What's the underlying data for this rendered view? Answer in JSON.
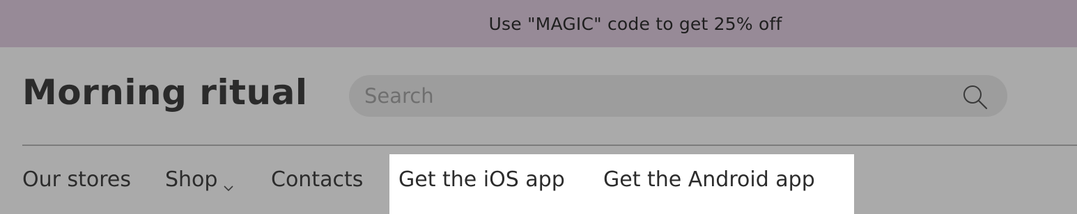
{
  "promo": {
    "text": "Use \"MAGIC\" code to get 25% off"
  },
  "header": {
    "logo": "Morning ritual",
    "search": {
      "placeholder": "Search",
      "value": "",
      "icon": "search-icon"
    }
  },
  "nav": {
    "items": [
      {
        "label": "Our stores"
      },
      {
        "label": "Shop",
        "icon": "chevron-down-icon"
      },
      {
        "label": "Contacts"
      },
      {
        "label": "Get the iOS app"
      },
      {
        "label": "Get the Android app"
      }
    ]
  },
  "colors": {
    "promo_background": "#978a97",
    "page_background": "#aaaaaa",
    "search_background": "#9d9d9d",
    "highlight_background": "#ffffff",
    "text": "#2a2a2a"
  }
}
